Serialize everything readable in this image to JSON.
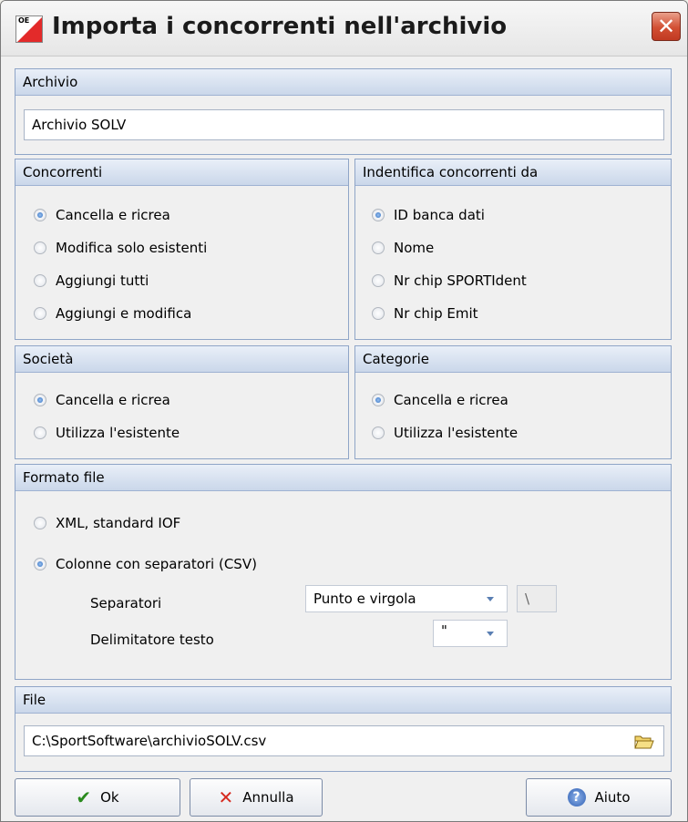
{
  "window": {
    "title": "Importa i concorrenti nell'archivio",
    "app_icon_text": "OE",
    "close_symbol": "✕"
  },
  "archivio": {
    "header": "Archivio",
    "value": "Archivio SOLV"
  },
  "concorrenti": {
    "header": "Concorrenti",
    "options": [
      "Cancella e ricrea",
      "Modifica solo esistenti",
      "Aggiungi tutti",
      "Aggiungi e modifica"
    ],
    "selected": 0
  },
  "identifica": {
    "header": "Indentifica concorrenti da",
    "options": [
      "ID banca dati",
      "Nome",
      "Nr chip SPORTIdent",
      "Nr chip Emit"
    ],
    "selected": 0
  },
  "societa": {
    "header": "Società",
    "options": [
      "Cancella e ricrea",
      "Utilizza l'esistente"
    ],
    "selected": 0
  },
  "categorie": {
    "header": "Categorie",
    "options": [
      "Cancella e ricrea",
      "Utilizza l'esistente"
    ],
    "selected": 0
  },
  "formato": {
    "header": "Formato file",
    "options": [
      "XML, standard IOF",
      "Colonne con separatori (CSV)"
    ],
    "selected": 1,
    "separatori_label": "Separatori",
    "separatori_value": "Punto e virgola",
    "separatori_custom": "\\",
    "delimitatore_label": "Delimitatore testo",
    "delimitatore_value": "\""
  },
  "file": {
    "header": "File",
    "path": "C:\\SportSoftware\\archivioSOLV.csv"
  },
  "buttons": {
    "ok": "Ok",
    "annulla": "Annulla",
    "aiuto": "Aiuto"
  },
  "colors": {
    "header_gradient_top": "#e9eff8",
    "header_gradient_bottom": "#cad7ea",
    "border": "#8fa5c7",
    "close": "#d24f33",
    "ok_check": "#2a8a1e",
    "cancel_x": "#d62a1f",
    "help": "#2f5fb3"
  }
}
